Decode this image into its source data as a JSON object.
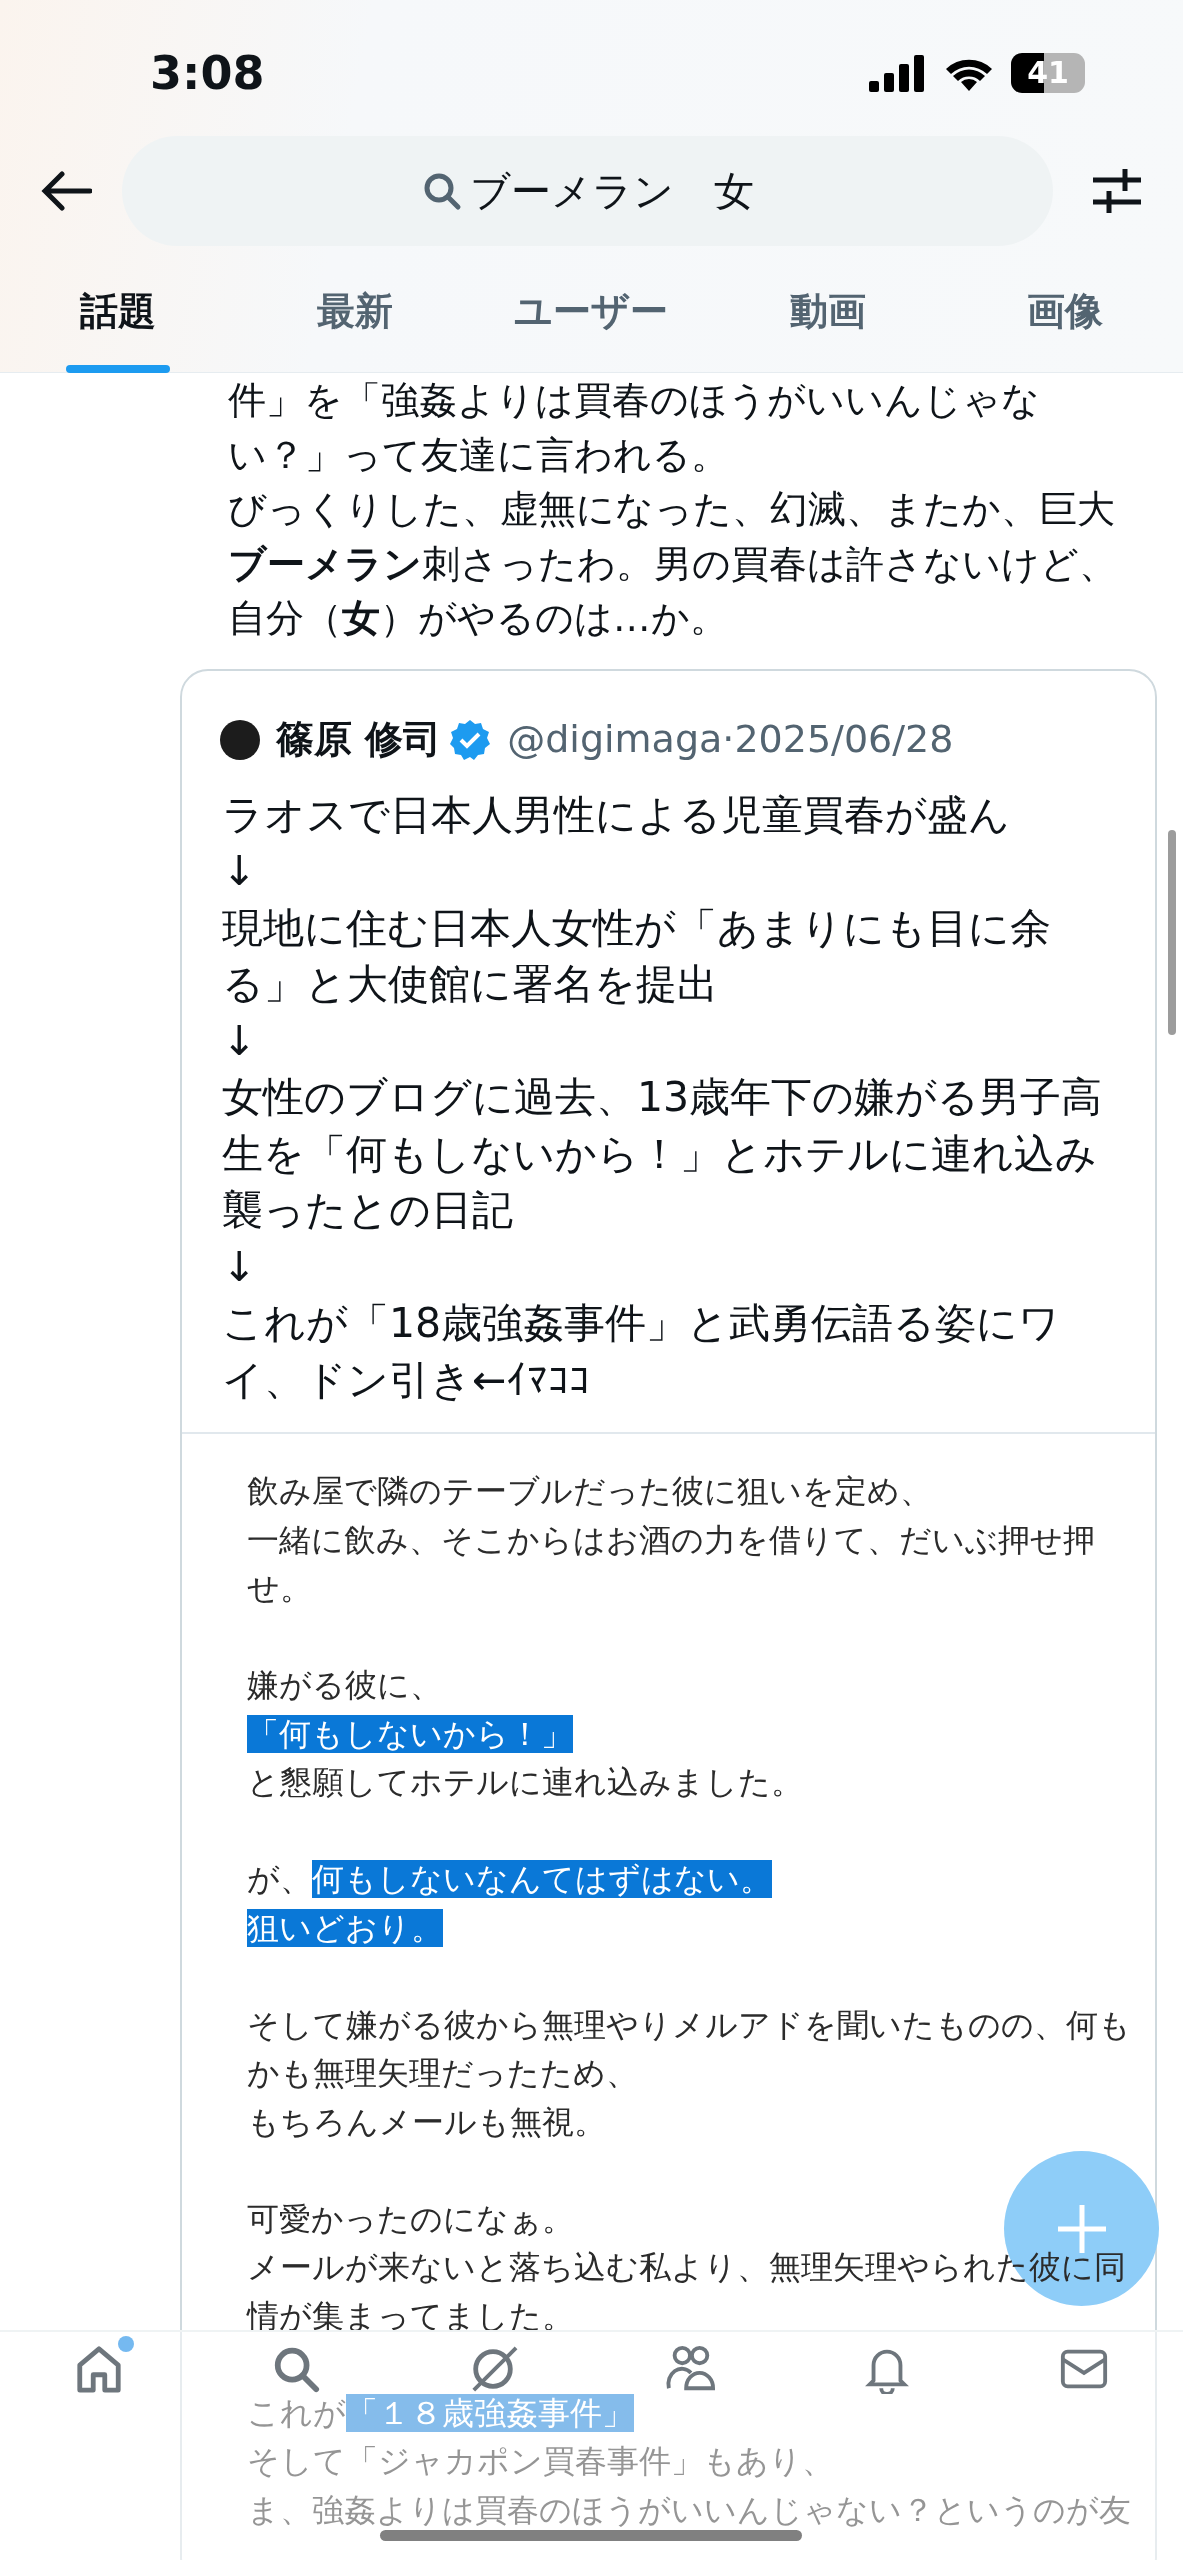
{
  "status_bar": {
    "time": "3:08",
    "battery": "41"
  },
  "search": {
    "query": "ブーメラン　女"
  },
  "tabs": [
    {
      "label": "話題",
      "selected": true
    },
    {
      "label": "最新",
      "selected": false
    },
    {
      "label": "ユーザー",
      "selected": false
    },
    {
      "label": "動画",
      "selected": false
    },
    {
      "label": "画像",
      "selected": false
    }
  ],
  "post": {
    "paragraphs": [
      "件」を「強姦よりは買春のほうがいいんじゃない？」って友達に言われる。",
      "びっくりした、虚無になった、幻滅、またか、巨大**ブーメラン**刺さったわ。男の買春は許さないけど、自分（**女**）がやるのは…か。"
    ]
  },
  "quote": {
    "author": "篠原 修司",
    "verified": true,
    "handle": "@digimaga",
    "separator": "·",
    "date": "2025/06/28",
    "paragraphs": [
      "ラオスで日本人男性による児童買春が盛ん",
      "↓",
      "現地に住む日本人女性が「あまりにも目に余る」と大使館に署名を提出",
      "↓",
      "女性のブログに過去、13歳年下の嫌がる男子高生を「何もしないから！」とホテルに連れ込み襲ったとの日記",
      "↓",
      "これが「18歳強姦事件」と武勇伝語る姿にワイ、ドン引き←ｲﾏｺｺ"
    ],
    "image_paragraphs": [
      [
        [
          {
            "text": "飲み屋で隣のテーブルだった彼に狙いを定め、",
            "highlighted": false
          }
        ],
        [
          {
            "text": "一緒に飲み、そこからはお酒の力を借りて、だいぶ押せ押",
            "highlighted": false
          }
        ],
        [
          {
            "text": "せ。",
            "highlighted": false
          }
        ]
      ],
      [
        [
          {
            "text": "嫌がる彼に、",
            "highlighted": false
          }
        ],
        [
          {
            "text": "「何もしないから！」",
            "highlighted": true
          }
        ],
        [
          {
            "text": "と懇願してホテルに連れ込みました。",
            "highlighted": false
          }
        ]
      ],
      [
        [
          {
            "text": "が、",
            "highlighted": false
          },
          {
            "text": "何もしないなんてはずはない。",
            "highlighted": true
          }
        ],
        [
          {
            "text": "狙いどおり。",
            "highlighted": true
          }
        ]
      ],
      [
        [
          {
            "text": "そして嫌がる彼から無理やりメルアドを聞いたものの、何も",
            "highlighted": false
          }
        ],
        [
          {
            "text": "かも無理矢理だったため、",
            "highlighted": false
          }
        ],
        [
          {
            "text": "もちろんメールも無視。",
            "highlighted": false
          }
        ]
      ],
      [
        [
          {
            "text": "可愛かったのになぁ。",
            "highlighted": false
          }
        ],
        [
          {
            "text": "メールが来ないと落ち込む私より、無理矢理やられた彼に同",
            "highlighted": false
          }
        ],
        [
          {
            "text": "情が集まってました。",
            "highlighted": false
          }
        ]
      ],
      [
        [
          {
            "text": "これが",
            "highlighted": false
          },
          {
            "text": "「１８歳強姦事件」",
            "highlighted": true
          }
        ],
        [
          {
            "text": "そして「ジャカポン買春事件」もあり、",
            "highlighted": false
          }
        ],
        [
          {
            "text": "ま、強姦よりは買春のほうがいいんじゃない？というのが友",
            "highlighted": false
          }
        ]
      ]
    ]
  },
  "bottom_nav": [
    {
      "kind": "home",
      "dot": true
    },
    {
      "kind": "search",
      "dot": false
    },
    {
      "kind": "grok",
      "dot": false
    },
    {
      "kind": "people",
      "dot": false
    },
    {
      "kind": "bell",
      "dot": false
    },
    {
      "kind": "mail",
      "dot": false
    }
  ]
}
